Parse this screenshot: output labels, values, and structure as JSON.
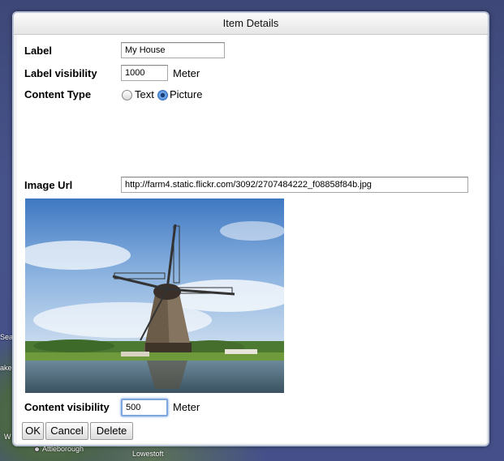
{
  "map": {
    "labels": [
      "Sea",
      "ake",
      "Attleborough",
      "Lowestoft",
      "W"
    ]
  },
  "dialog": {
    "title": "Item Details",
    "label": {
      "caption": "Label",
      "value": "My House"
    },
    "label_visibility": {
      "caption": "Label visibility",
      "value": "1000",
      "unit": "Meter"
    },
    "content_type": {
      "caption": "Content Type",
      "options": [
        {
          "label": "Text",
          "checked": false
        },
        {
          "label": "Picture",
          "checked": true
        }
      ]
    },
    "image_url": {
      "caption": "Image Url",
      "value": "http://farm4.static.flickr.com/3092/2707484222_f08858f84b.jpg"
    },
    "content_visibility": {
      "caption": "Content visibility",
      "value": "500",
      "unit": "Meter"
    },
    "buttons": {
      "ok": "OK",
      "cancel": "Cancel",
      "delete": "Delete"
    }
  }
}
